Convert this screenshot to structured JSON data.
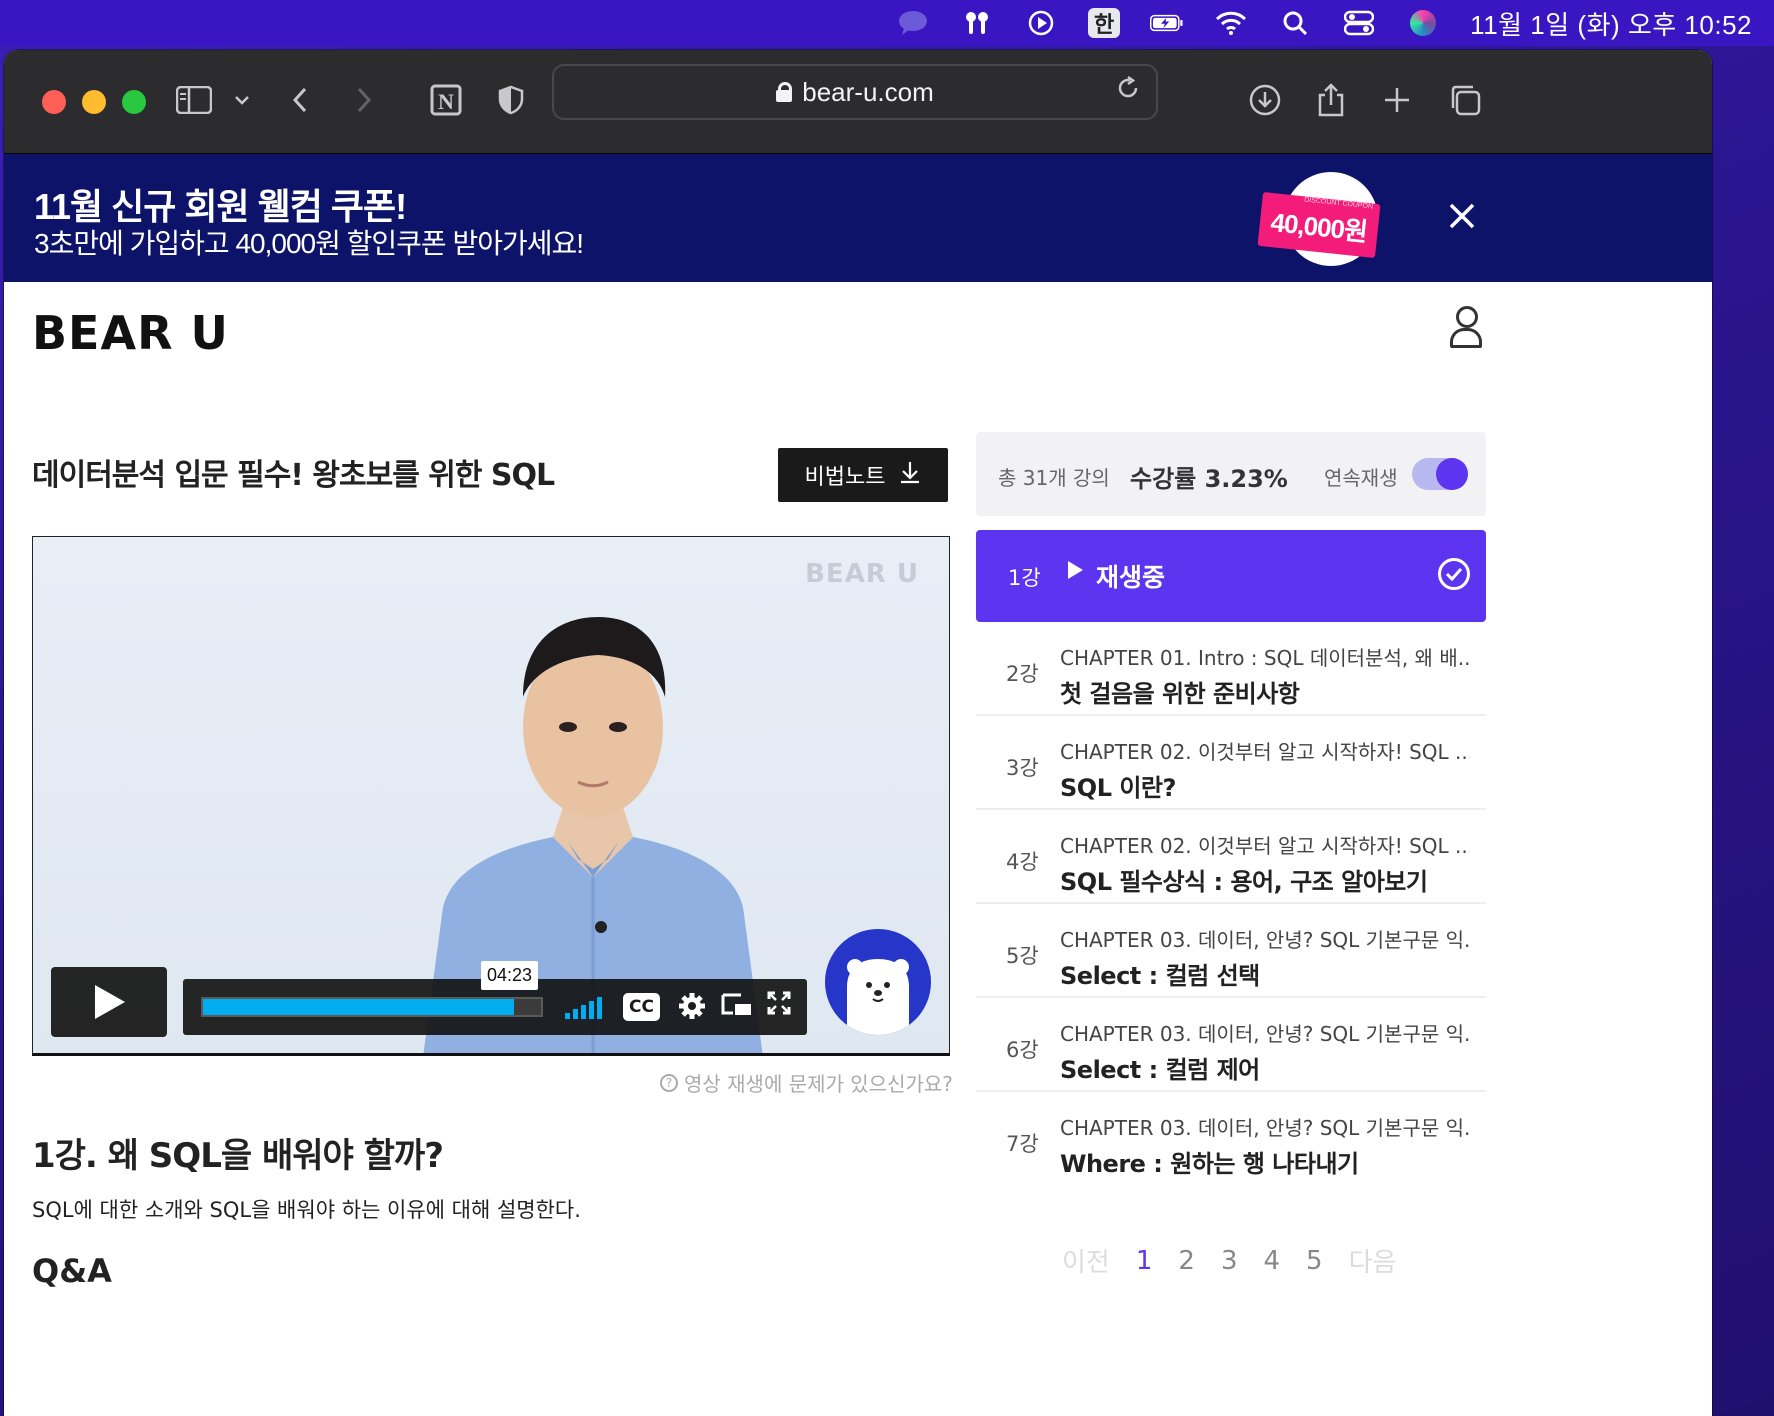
{
  "menubar": {
    "icons": [
      "chat-icon",
      "airpods-icon",
      "play-circle-icon",
      "battery-icon",
      "wifi-icon",
      "search-icon",
      "control-center-icon",
      "siri-icon"
    ],
    "input_source": "한",
    "clock": "11월 1일 (화) 오후 10:52"
  },
  "browser": {
    "url": "bear-u.com"
  },
  "banner": {
    "title": "11월 신규 회원 웰컴 쿠폰!",
    "subtitle": "3초만에 가입하고 40,000원 할인쿠폰 받아가세요!",
    "coupon_amount": "40,000원",
    "coupon_small": "DISCOUNT COUPON"
  },
  "site": {
    "logo": "BEAR U",
    "course_title": "데이터분석 입문 필수!  왕초보를 위한 SQL",
    "note_button": "비법노트"
  },
  "video": {
    "watermark": "BEAR U",
    "time": "04:23",
    "progress_fraction": 0.92,
    "report_link": "영상 재생에 문제가 있으신가요?"
  },
  "lesson": {
    "title": "1강. 왜 SQL을 배워야 할까?",
    "description": "SQL에 대한 소개와 SQL을 배워야 하는 이유에 대해 설명한다.",
    "qa_heading": "Q&A"
  },
  "panel": {
    "total": "총 31개 강의",
    "rate": "수강률 3.23%",
    "autoplay_label": "연속재생",
    "autoplay_on": true,
    "now_playing": {
      "num": "1강",
      "label": "재생중"
    },
    "lessons": [
      {
        "num": "2강",
        "chapter": "CHAPTER 01. Intro : SQL 데이터분석, 왜 배...",
        "title": "첫 걸음을 위한 준비사항"
      },
      {
        "num": "3강",
        "chapter": "CHAPTER 02. 이것부터 알고 시작하자! SQL ...",
        "title": "SQL 이란?"
      },
      {
        "num": "4강",
        "chapter": "CHAPTER 02. 이것부터 알고 시작하자! SQL ...",
        "title": "SQL 필수상식 : 용어, 구조 알아보기"
      },
      {
        "num": "5강",
        "chapter": "CHAPTER 03. 데이터, 안녕? SQL 기본구문 익...",
        "title": "Select : 컬럼 선택"
      },
      {
        "num": "6강",
        "chapter": "CHAPTER 03. 데이터, 안녕? SQL 기본구문 익...",
        "title": "Select : 컬럼 제어"
      },
      {
        "num": "7강",
        "chapter": "CHAPTER 03. 데이터, 안녕? SQL 기본구문 익...",
        "title": "Where : 원하는 행 나타내기"
      }
    ],
    "pager": {
      "prev": "이전",
      "pages": [
        "1",
        "2",
        "3",
        "4",
        "5"
      ],
      "next": "다음",
      "active": "1"
    }
  }
}
